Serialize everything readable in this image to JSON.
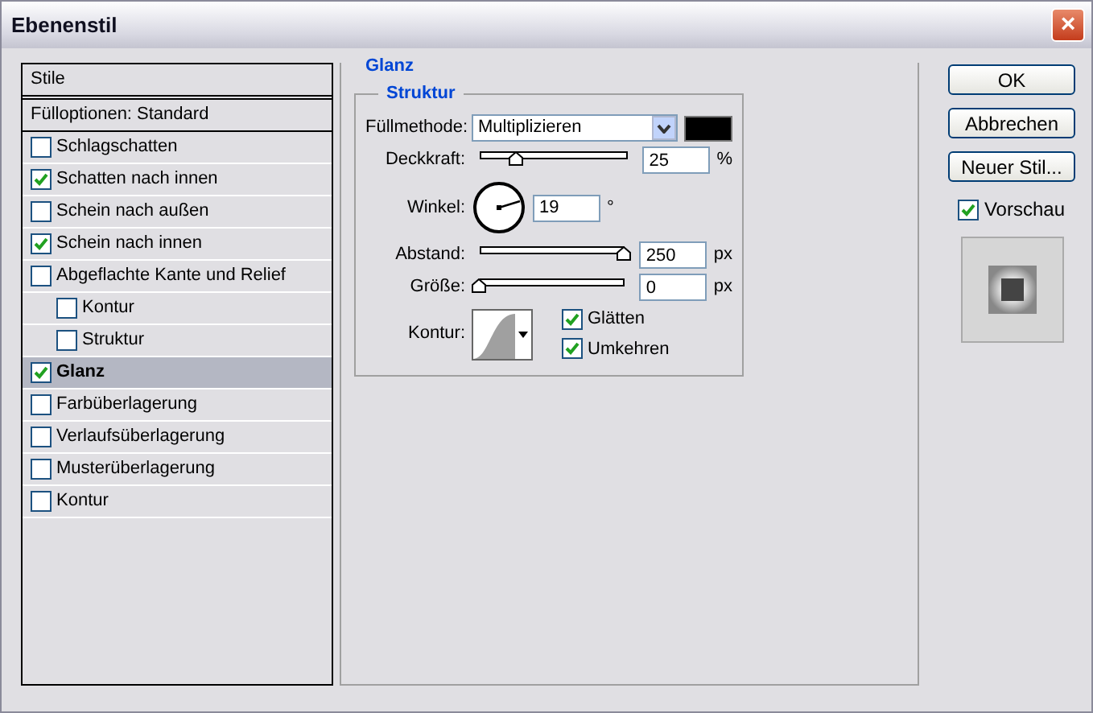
{
  "window": {
    "title": "Ebenenstil",
    "close": "×"
  },
  "styles": {
    "header": "Stile",
    "options": "Fülloptionen: Standard",
    "items": [
      {
        "label": "Schlagschatten",
        "checked": false,
        "selected": false
      },
      {
        "label": "Schatten nach innen",
        "checked": true,
        "selected": false
      },
      {
        "label": "Schein nach außen",
        "checked": false,
        "selected": false
      },
      {
        "label": "Schein nach innen",
        "checked": true,
        "selected": false
      },
      {
        "label": "Abgeflachte Kante und Relief",
        "checked": false,
        "selected": false,
        "children": [
          {
            "label": "Kontur",
            "checked": false,
            "selected": false
          },
          {
            "label": "Struktur",
            "checked": false,
            "selected": false
          }
        ]
      },
      {
        "label": "Glanz",
        "checked": true,
        "selected": true
      },
      {
        "label": "Farbüberlagerung",
        "checked": false,
        "selected": false
      },
      {
        "label": "Verlaufsüberlagerung",
        "checked": false,
        "selected": false
      },
      {
        "label": "Musterüberlagerung",
        "checked": false,
        "selected": false
      },
      {
        "label": "Kontur",
        "checked": false,
        "selected": false
      }
    ]
  },
  "panel": {
    "title": "Glanz",
    "group": "Struktur",
    "blend": {
      "label": "Füllmethode:",
      "value": "Multiplizieren",
      "color": "#000000"
    },
    "sliders": [
      {
        "label": "Deckkraft:",
        "level": 0.25,
        "value": "25",
        "unit": "%"
      },
      {
        "kind": "angle",
        "label": "Winkel:",
        "value": "19",
        "unit": "°"
      },
      {
        "label": "Abstand:",
        "level": 1.0,
        "value": "250",
        "unit": "px"
      },
      {
        "label": "Größe:",
        "level": 0.0,
        "value": "0",
        "unit": "px"
      }
    ],
    "contour": {
      "label": "Kontur:",
      "options": [
        {
          "label": "Glätten",
          "checked": true
        },
        {
          "label": "Umkehren",
          "checked": true
        }
      ]
    }
  },
  "buttons": [
    "OK",
    "Abbrechen",
    "Neuer Stil..."
  ],
  "preview": {
    "label": "Vorschau",
    "checked": true
  }
}
